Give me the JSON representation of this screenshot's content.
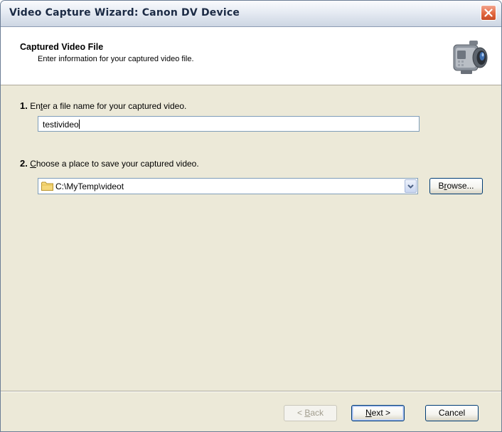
{
  "window": {
    "title": "Video Capture Wizard: Canon DV Device",
    "close_icon": "close-icon"
  },
  "header": {
    "title": "Captured Video File",
    "subtitle": "Enter information for your captured video file.",
    "icon": "camcorder-icon"
  },
  "step1": {
    "number": "1.",
    "label_pre": "En",
    "label_mnemonic": "t",
    "label_post": "er a file name for your captured video.",
    "value": "testivideo"
  },
  "step2": {
    "number": "2.",
    "label_mnemonic": "C",
    "label_post": "hoose a place to save your captured video.",
    "value": "C:\\MyTemp\\videot",
    "folder_icon": "folder-icon",
    "dropdown_icon": "chevron-down-icon"
  },
  "buttons": {
    "browse_pre": "B",
    "browse_mnemonic": "r",
    "browse_post": "owse...",
    "back_pre": "< ",
    "back_mnemonic": "B",
    "back_post": "ack",
    "next_mnemonic": "N",
    "next_post": "ext >",
    "cancel": "Cancel"
  }
}
